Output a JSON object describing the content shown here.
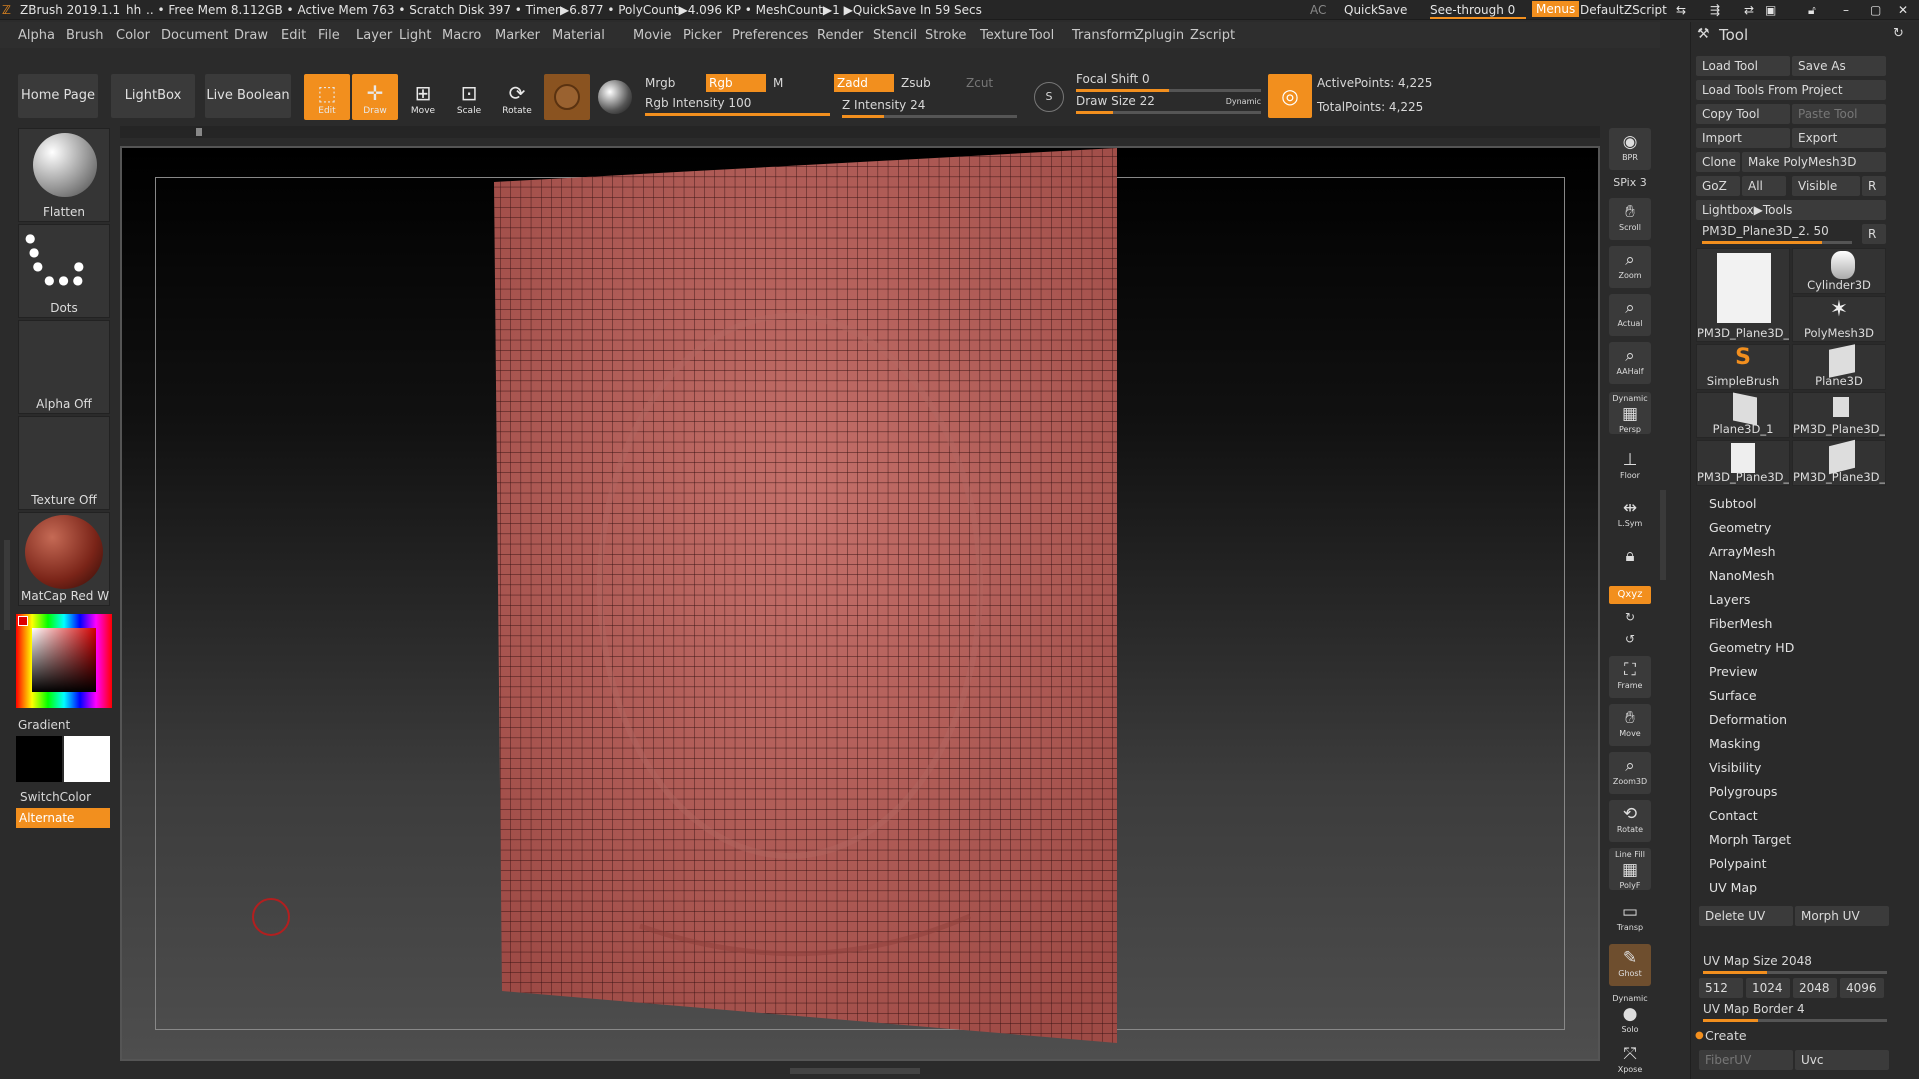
{
  "titlebar": {
    "app": "ZBrush 2019.1.1",
    "doc": "hh",
    "stats": ".. • Free Mem 8.112GB • Active Mem 763 • Scratch Disk 397 • Timer▶6.877 • PolyCount▶4.096 KP • MeshCount▶1 ▶QuickSave In 59 Secs",
    "ac": "AC",
    "quicksave": "QuickSave",
    "seethrough": "See-through 0",
    "menus": "Menus",
    "script": "DefaultZScript"
  },
  "menu": [
    "Alpha",
    "Brush",
    "Color",
    "Document",
    "Draw",
    "Edit",
    "File",
    "Layer",
    "Light",
    "Macro",
    "Marker",
    "Material",
    "Movie",
    "Picker",
    "Preferences",
    "Render",
    "Stencil",
    "Stroke",
    "Texture",
    "Tool",
    "Transform",
    "Zplugin",
    "Zscript"
  ],
  "toolbar": {
    "home": "Home Page",
    "lightbox": "LightBox",
    "liveboolean": "Live Boolean",
    "edit": "Edit",
    "draw": "Draw",
    "move": "Move",
    "scale": "Scale",
    "rotate": "Rotate",
    "mrgb": "Mrgb",
    "rgb": "Rgb",
    "m": "M",
    "zadd": "Zadd",
    "zsub": "Zsub",
    "zcut": "Zcut",
    "rgb_intensity": "Rgb Intensity 100",
    "z_intensity": "Z Intensity 24",
    "focal_shift": "Focal Shift 0",
    "draw_size": "Draw Size 22",
    "dynamic": "Dynamic",
    "active_points": "ActivePoints: 4,225",
    "total_points": "TotalPoints: 4,225",
    "rgb_intensity_fraction": 1.0,
    "z_intensity_fraction": 0.24,
    "focal_shift_fraction": 0.5,
    "draw_size_fraction": 0.2
  },
  "left": {
    "brush": "Flatten",
    "stroke": "Dots",
    "alpha": "Alpha Off",
    "texture": "Texture Off",
    "material": "MatCap Red Wax",
    "gradient": "Gradient",
    "switchcolor": "SwitchColor",
    "alternate": "Alternate"
  },
  "rightshelf": {
    "bpr": "BPR",
    "spix": "SPix 3",
    "scroll": "Scroll",
    "zoom": "Zoom",
    "actual": "Actual",
    "aahalf": "AAHalf",
    "dynamic": "Dynamic",
    "persp": "Persp",
    "floor": "Floor",
    "lsym": "L.Sym",
    "xyz": "Qxyz",
    "frame": "Frame",
    "move": "Move",
    "zoom3d": "Zoom3D",
    "rotate": "Rotate",
    "linefill": "Line Fill",
    "polyf": "PolyF",
    "transp": "Transp",
    "ghost": "Ghost",
    "solo": "Solo",
    "xpose": "Xpose"
  },
  "tool": {
    "title": "Tool",
    "load_tool": "Load Tool",
    "save_as": "Save As",
    "load_from_project": "Load Tools From Project",
    "copy_tool": "Copy Tool",
    "paste_tool": "Paste Tool",
    "import": "Import",
    "export": "Export",
    "clone": "Clone",
    "make_polymesh": "Make PolyMesh3D",
    "goz": "GoZ",
    "all": "All",
    "visible": "Visible",
    "r": "R",
    "lightbox_tools": "Lightbox▶Tools",
    "current_tool": "PM3D_Plane3D_2. 50",
    "current_tool_slider": 0.8,
    "thumbs": [
      "PM3D_Plane3D_",
      "Cylinder3D",
      "PolyMesh3D",
      "SimpleBrush",
      "Plane3D",
      "Plane3D_1",
      "PM3D_Plane3D_",
      "PM3D_Plane3D_",
      "PM3D_Plane3D_"
    ],
    "sections": [
      "Subtool",
      "Geometry",
      "ArrayMesh",
      "NanoMesh",
      "Layers",
      "FiberMesh",
      "Geometry HD",
      "Preview",
      "Surface",
      "Deformation",
      "Masking",
      "Visibility",
      "Polygroups",
      "Contact",
      "Morph Target",
      "Polypaint",
      "UV Map"
    ],
    "delete_uv": "Delete UV",
    "morph_uv": "Morph UV",
    "uv_map_size": "UV Map Size 2048",
    "uv_map_size_fraction": 0.35,
    "sizes": [
      "512",
      "1024",
      "2048",
      "4096"
    ],
    "uv_map_border": "UV Map Border 4",
    "uv_map_border_fraction": 0.3,
    "create": "Create",
    "fiberuv": "FiberUV",
    "uvc": "Uvc"
  }
}
